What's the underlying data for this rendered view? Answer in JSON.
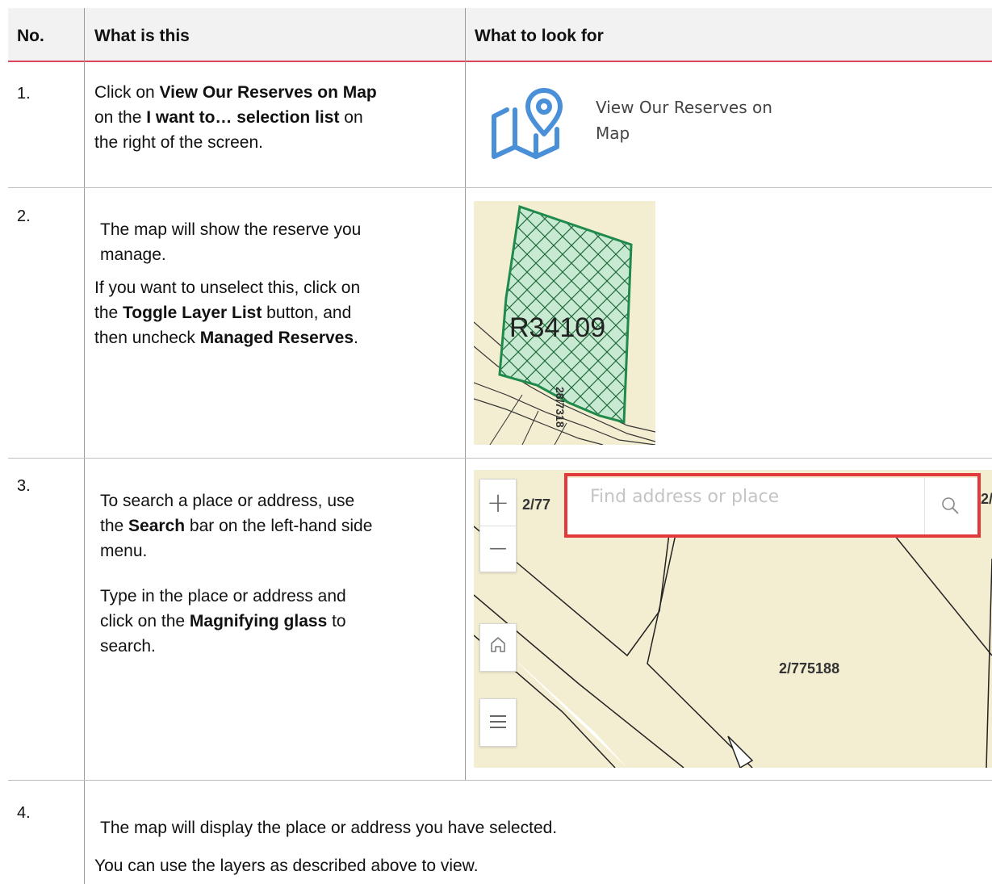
{
  "table": {
    "headers": {
      "no": "No.",
      "what": "What is this",
      "look": "What to look for"
    },
    "rows": [
      {
        "num": "1.",
        "text_parts": [
          [
            "Click on ",
            "View Our Reserves on Map",
            ""
          ],
          [
            " on the ",
            "I want to… selection list",
            " on"
          ],
          [
            "the right of the screen.",
            "",
            ""
          ]
        ],
        "icon": "map-pin-icon",
        "icon_label_line1": "View Our Reserves on",
        "icon_label_line2": "Map"
      },
      {
        "num": "2.",
        "para1_line1": "The map will show the reserve you",
        "para1_line2": "manage.",
        "para2_line1": "If you want to unselect this, click on",
        "para2_pre": "the ",
        "para2_bold1": "Toggle Layer List",
        "para2_post1": " button, and",
        "para2_pre2": "then uncheck ",
        "para2_bold2": "Managed Reserves",
        "para2_post2": ".",
        "parcel_label": "R34109",
        "parcel_sub_label": "28/7318"
      },
      {
        "num": "3.",
        "para1_line1": "To search a place or address, use",
        "para1_pre": "the ",
        "para1_bold": "Search",
        "para1_post": " bar on the left-hand side",
        "para1_line3": "menu.",
        "para2_line1": "Type in the place or address and",
        "para2_pre": "click on the ",
        "para2_bold": "Magnifying glass",
        "para2_post": " to",
        "para2_line3": "search.",
        "map": {
          "zoom_in": "+",
          "zoom_out": "—",
          "home_icon": "home-icon",
          "menu_icon": "menu-icon",
          "search_placeholder": "Find address or place",
          "search_icon": "search-icon",
          "parcel_label_left": "2/77",
          "parcel_label_right": "2/",
          "parcel_label_center": "2/775188"
        }
      },
      {
        "num": "4.",
        "line1": "The map will display the place or address you have selected.",
        "line2": "You can use the layers as described above to view."
      }
    ]
  },
  "colors": {
    "header_bg": "#f2f2f2",
    "header_rule": "#d9455a",
    "map_bg": "#f3eed2",
    "search_highlight": "#e23a3a",
    "icon_blue": "#4a90d9",
    "parcel_green": "#2e8b57"
  }
}
